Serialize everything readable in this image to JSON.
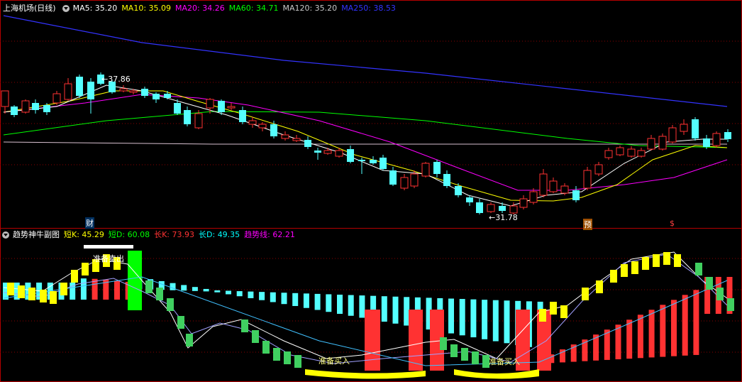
{
  "main": {
    "title": "上海机场(日线)",
    "ma": [
      {
        "label": "MA5: 35.20",
        "color": "#ffffff"
      },
      {
        "label": "MA10: 35.09",
        "color": "#ffff00"
      },
      {
        "label": "MA20: 34.26",
        "color": "#ff00ff"
      },
      {
        "label": "MA60: 34.71",
        "color": "#00ff00"
      },
      {
        "label": "MA120: 35.20",
        "color": "#c8c8c8"
      },
      {
        "label": "MA250: 38.53",
        "color": "#3333ff"
      }
    ],
    "high_label": "←37.86",
    "low_label": "←31.78",
    "marker_cai": "财",
    "marker_yu": "预",
    "marker_s": "$"
  },
  "sub": {
    "title": "趋势神牛副图",
    "values": [
      {
        "label": "短K: 45.29",
        "color": "#ffff00"
      },
      {
        "label": "短D: 60.08",
        "color": "#00ff00"
      },
      {
        "label": "长K: 73.93",
        "color": "#ff3333"
      },
      {
        "label": "长D: 49.35",
        "color": "#00ffff"
      },
      {
        "label": "趋势线: 62.21",
        "color": "#ff00ff"
      }
    ],
    "sell_label": "准备卖出",
    "buy_label_1": "准备买入",
    "buy_label_2": "准备买入"
  },
  "colors": {
    "up": "#ff3232",
    "down": "#54ffff",
    "grid": "#8b0000",
    "border": "#b40000"
  }
}
